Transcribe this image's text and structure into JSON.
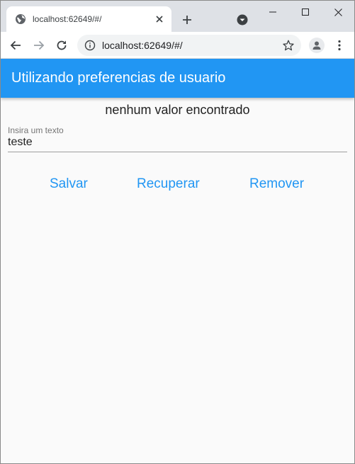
{
  "browser": {
    "tab": {
      "title": "localhost:62649/#/",
      "favicon": "globe-icon"
    },
    "address_bar": {
      "url": "localhost:62649/#/"
    },
    "icons": {
      "back": "arrow-left-icon",
      "forward": "arrow-right-icon",
      "reload": "reload-icon",
      "info": "info-icon",
      "star": "star-icon",
      "profile": "person-icon",
      "menu": "kebab-menu-icon",
      "new_tab": "plus-icon",
      "tab_search": "chevron-down-icon",
      "minimize": "minimize-icon",
      "maximize": "maximize-icon",
      "close": "close-icon"
    }
  },
  "app": {
    "title": "Utilizando preferencias de usuario",
    "accent_color": "#2196f3",
    "status_text": "nenhum valor encontrado",
    "input": {
      "label": "Insira um texto",
      "value": "teste"
    },
    "buttons": {
      "save": "Salvar",
      "retrieve": "Recuperar",
      "remove": "Remover"
    }
  }
}
